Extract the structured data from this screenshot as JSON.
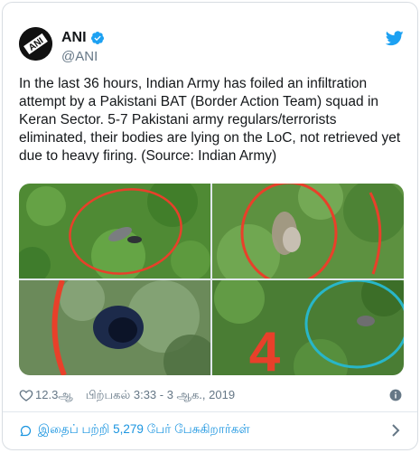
{
  "account": {
    "name": "ANI",
    "handle": "@ANI",
    "avatar_text": "ANI"
  },
  "tweet": {
    "text": "In the last 36 hours, Indian Army has foiled an infiltration attempt by a Pakistani BAT (Border Action Team) squad in Keran Sector. 5-7 Pakistani army regulars/terrorists eliminated, their bodies are lying on the LoC, not retrieved yet due to heavy firing. (Source: Indian Army)",
    "media": {
      "image_count": 4,
      "overlay_text": "4"
    }
  },
  "meta": {
    "likes": "12.3ஆ",
    "timestamp": "பிற்பகல் 3:33 - 3 ஆக., 2019"
  },
  "footer": {
    "conversation_label": "இதைப் பற்றி 5,279 பேர் பேசுகிறார்கள்"
  },
  "icons": {
    "verified": "verified-badge-icon",
    "bird": "twitter-bird-icon",
    "heart": "heart-icon",
    "info": "info-icon",
    "bubble": "speech-bubble-icon",
    "chevron": "chevron-right-icon"
  },
  "colors": {
    "brand_blue": "#1da1f2",
    "link_blue": "#1b95e0",
    "muted_text": "#657786",
    "text": "#14171a",
    "red_circle": "#e8402a",
    "cyan_circle": "#28b6c8"
  }
}
